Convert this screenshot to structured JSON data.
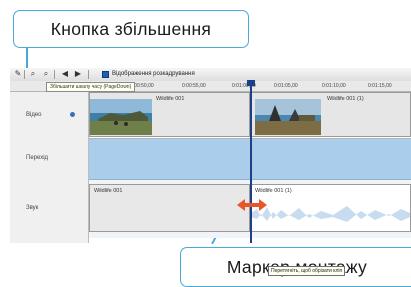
{
  "callouts": {
    "top": "Кнопка  збільшення",
    "bottom": "Маркер  монтажу"
  },
  "toolbar": {
    "label": "Відображення розкадрування"
  },
  "ruler": {
    "times": [
      "0:00:50,00",
      "0:00:55,00",
      "0:01:00,00",
      "0:01:05,00",
      "0:01:10,00",
      "0:01:15,00"
    ],
    "tooltip": "Збільшити шкалу часу (PageDown)"
  },
  "tracks": {
    "video": "Відео",
    "transition": "Перехід",
    "audio": "Звук"
  },
  "clips": {
    "video_left": "Wildlife 001",
    "video_right": "Wildlife 001 (1)",
    "audio_left": "Wildlife 001",
    "audio_right": "Wildlife 001 (1)"
  },
  "hint": "Перетягніть, щоб обрізати кліп",
  "colors": {
    "callout_border": "#49a9d8",
    "marker": "#1c3f8a",
    "transition_track": "#a9cdea",
    "arrow": "#e8572a"
  }
}
